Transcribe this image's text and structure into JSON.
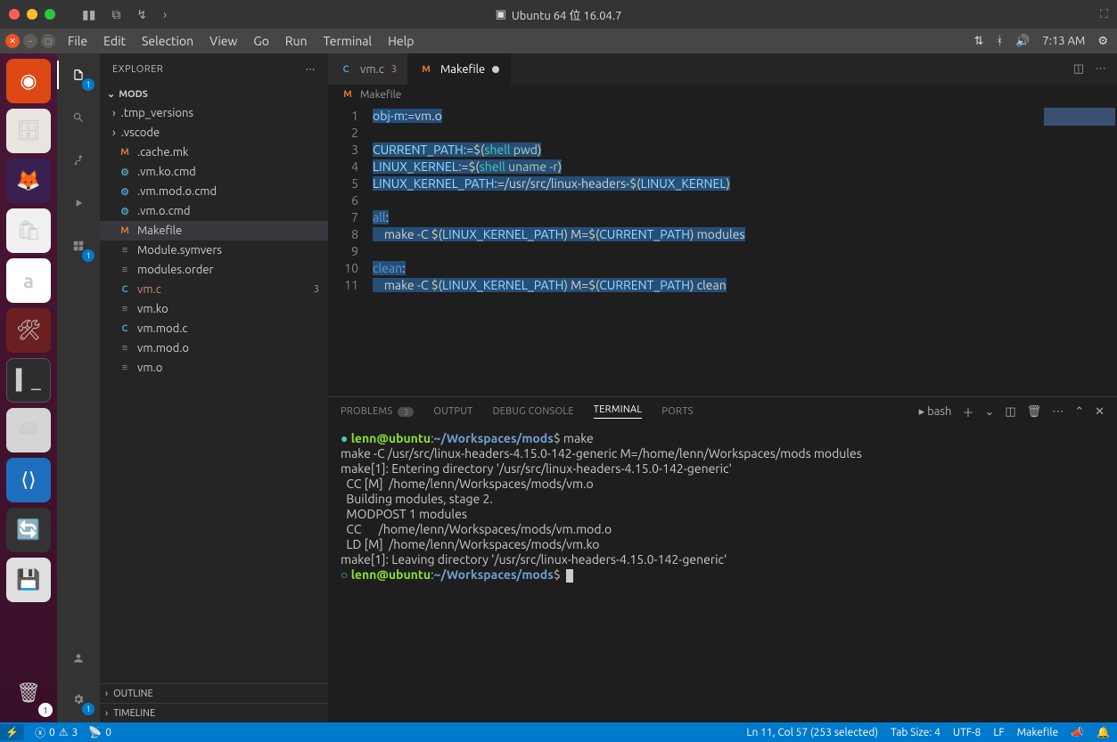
{
  "vm": {
    "title": "Ubuntu 64 位 16.04.7"
  },
  "gnome": {
    "menus": [
      "File",
      "Edit",
      "Selection",
      "View",
      "Go",
      "Run",
      "Terminal",
      "Help"
    ],
    "time": "7:13 AM"
  },
  "explorer": {
    "title": "EXPLORER",
    "section": "MODS",
    "items": [
      {
        "type": "folder",
        "name": ".tmp_versions"
      },
      {
        "type": "folder",
        "name": ".vscode"
      },
      {
        "type": "file",
        "icon": "m",
        "name": ".cache.mk"
      },
      {
        "type": "file",
        "icon": "gear",
        "name": ".vm.ko.cmd"
      },
      {
        "type": "file",
        "icon": "gear",
        "name": ".vm.mod.o.cmd"
      },
      {
        "type": "file",
        "icon": "gear",
        "name": ".vm.o.cmd"
      },
      {
        "type": "file",
        "icon": "m",
        "name": "Makefile",
        "selected": true
      },
      {
        "type": "file",
        "icon": "txt",
        "name": "Module.symvers"
      },
      {
        "type": "file",
        "icon": "txt",
        "name": "modules.order"
      },
      {
        "type": "file",
        "icon": "c",
        "name": "vm.c",
        "modc": true,
        "badge": "3"
      },
      {
        "type": "file",
        "icon": "txt",
        "name": "vm.ko"
      },
      {
        "type": "file",
        "icon": "c",
        "name": "vm.mod.c"
      },
      {
        "type": "file",
        "icon": "txt",
        "name": "vm.mod.o"
      },
      {
        "type": "file",
        "icon": "txt",
        "name": "vm.o"
      }
    ],
    "outline": "OUTLINE",
    "timeline": "TIMELINE"
  },
  "tabs": [
    {
      "icon": "c",
      "label": "vm.c",
      "badge": "3"
    },
    {
      "icon": "m",
      "label": "Makefile",
      "active": true,
      "dirty": true
    }
  ],
  "breadcrumb": {
    "icon": "m",
    "label": "Makefile"
  },
  "code_lines": [
    {
      "n": 1,
      "html": "<span class='sel'><span class='var'>obj-m</span><span class='op'>:=</span>vm.o</span>"
    },
    {
      "n": 2,
      "html": ""
    },
    {
      "n": 3,
      "html": "<span class='sel'><span class='var'>CURRENT_PATH</span><span class='op'>:=</span><span class='pun'>$(</span><span class='fn'>shell</span> <span class='arg'>pwd</span><span class='pun'>)</span></span>"
    },
    {
      "n": 4,
      "html": "<span class='sel'><span class='var'>LINUX_KERNEL</span><span class='op'>:=</span><span class='pun'>$(</span><span class='fn'>shell</span> <span class='arg'>uname</span> <span class='arg'>-r</span><span class='pun'>)</span></span>"
    },
    {
      "n": 5,
      "html": "<span class='sel'><span class='var'>LINUX_KERNEL_PATH</span><span class='op'>:=</span>/usr/src/linux-headers-<span class='pun'>$(</span><span class='var'>LINUX_KERNEL</span><span class='pun'>)</span></span>"
    },
    {
      "n": 6,
      "html": ""
    },
    {
      "n": 7,
      "html": "<span class='sel'><span class='kw'>all</span>:</span>"
    },
    {
      "n": 8,
      "html": "<span class='sel'>    make -C <span class='pun'>$(</span><span class='var'>LINUX_KERNEL_PATH</span><span class='pun'>)</span> M=<span class='pun'>$(</span><span class='var'>CURRENT_PATH</span><span class='pun'>)</span> modules</span>"
    },
    {
      "n": 9,
      "html": ""
    },
    {
      "n": 10,
      "html": "<span class='sel'><span class='kw'>clean</span>:</span>"
    },
    {
      "n": 11,
      "html": "<span class='sel'>    make -C <span class='pun'>$(</span><span class='var'>LINUX_KERNEL_PATH</span><span class='pun'>)</span> M=<span class='pun'>$(</span><span class='var'>CURRENT_PATH</span><span class='pun'>)</span> clean</span>"
    }
  ],
  "panel": {
    "tabs": {
      "problems": "PROBLEMS",
      "problems_count": "3",
      "output": "OUTPUT",
      "debug": "DEBUG CONSOLE",
      "terminal": "TERMINAL",
      "ports": "PORTS"
    },
    "shell": "bash"
  },
  "terminal_lines": [
    {
      "t": "prompt",
      "bullet": "●",
      "user": "lenn@ubuntu",
      "path": "~/Workspaces/mods",
      "cmd": "make"
    },
    {
      "t": "out",
      "text": "make -C /usr/src/linux-headers-4.15.0-142-generic M=/home/lenn/Workspaces/mods modules"
    },
    {
      "t": "out",
      "text": "make[1]: Entering directory '/usr/src/linux-headers-4.15.0-142-generic'"
    },
    {
      "t": "out",
      "text": "  CC [M]  /home/lenn/Workspaces/mods/vm.o"
    },
    {
      "t": "out",
      "text": "  Building modules, stage 2."
    },
    {
      "t": "out",
      "text": "  MODPOST 1 modules"
    },
    {
      "t": "out",
      "text": "  CC      /home/lenn/Workspaces/mods/vm.mod.o"
    },
    {
      "t": "out",
      "text": "  LD [M]  /home/lenn/Workspaces/mods/vm.ko"
    },
    {
      "t": "out",
      "text": "make[1]: Leaving directory '/usr/src/linux-headers-4.15.0-142-generic'"
    },
    {
      "t": "prompt",
      "bullet": "○",
      "user": "lenn@ubuntu",
      "path": "~/Workspaces/mods",
      "cmd": "",
      "cursor": true
    }
  ],
  "status": {
    "errors": "0",
    "warnings": "3",
    "ports": "0",
    "cursor": "Ln 11, Col 57 (253 selected)",
    "tabsize": "Tab Size: 4",
    "encoding": "UTF-8",
    "eol": "LF",
    "lang": "Makefile"
  },
  "activity_badges": {
    "explorer": "1",
    "extensions": "1",
    "settings": "1"
  }
}
